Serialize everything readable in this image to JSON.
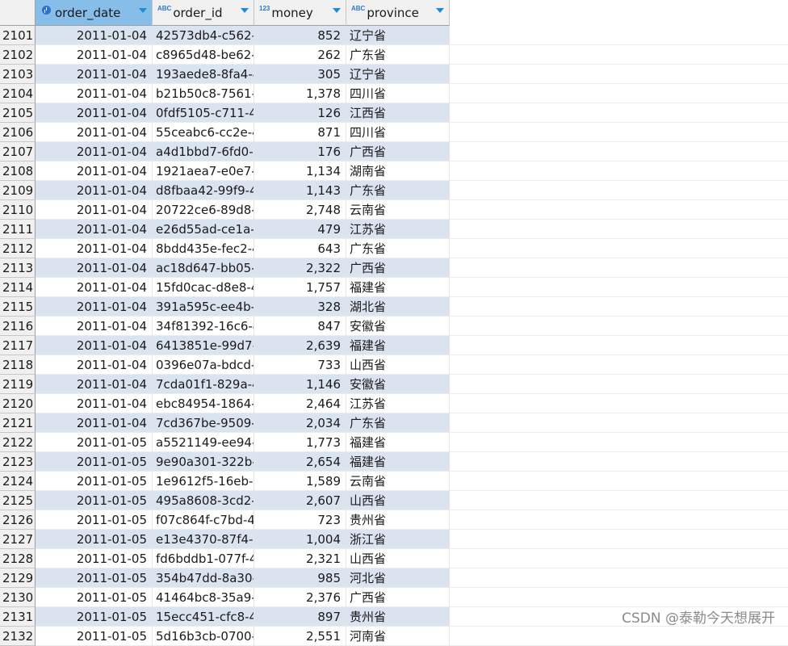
{
  "columns": [
    {
      "name": "order_date",
      "type_icon": "clock-icon",
      "type_label": ""
    },
    {
      "name": "order_id",
      "type_icon": "text-type-icon",
      "type_label": "ABC"
    },
    {
      "name": "money",
      "type_icon": "number-type-icon",
      "type_label": "123"
    },
    {
      "name": "province",
      "type_icon": "text-type-icon",
      "type_label": "ABC"
    }
  ],
  "rows": [
    {
      "n": "2101",
      "date": "2011-01-04",
      "id": "42573db4-c562-",
      "money": "852",
      "prov": "辽宁省"
    },
    {
      "n": "2102",
      "date": "2011-01-04",
      "id": "c8965d48-be62-",
      "money": "262",
      "prov": "广东省"
    },
    {
      "n": "2103",
      "date": "2011-01-04",
      "id": "193aede8-8fa4-4",
      "money": "305",
      "prov": "辽宁省"
    },
    {
      "n": "2104",
      "date": "2011-01-04",
      "id": "b21b50c8-7561-",
      "money": "1,378",
      "prov": "四川省"
    },
    {
      "n": "2105",
      "date": "2011-01-04",
      "id": "0fdf5105-c711-4",
      "money": "126",
      "prov": "江西省"
    },
    {
      "n": "2106",
      "date": "2011-01-04",
      "id": "55ceabc6-cc2e-4",
      "money": "871",
      "prov": "四川省"
    },
    {
      "n": "2107",
      "date": "2011-01-04",
      "id": "a4d1bbd7-6fd0-",
      "money": "176",
      "prov": "广西省"
    },
    {
      "n": "2108",
      "date": "2011-01-04",
      "id": "1921aea7-e0e7-4",
      "money": "1,134",
      "prov": "湖南省"
    },
    {
      "n": "2109",
      "date": "2011-01-04",
      "id": "d8fbaa42-99f9-4",
      "money": "1,143",
      "prov": "广东省"
    },
    {
      "n": "2110",
      "date": "2011-01-04",
      "id": "20722ce6-89d8-",
      "money": "2,748",
      "prov": "云南省"
    },
    {
      "n": "2111",
      "date": "2011-01-04",
      "id": "e26d55ad-ce1a-",
      "money": "479",
      "prov": "江苏省"
    },
    {
      "n": "2112",
      "date": "2011-01-04",
      "id": "8bdd435e-fec2-4",
      "money": "643",
      "prov": "广东省"
    },
    {
      "n": "2113",
      "date": "2011-01-04",
      "id": "ac18d647-bb05-",
      "money": "2,322",
      "prov": "广西省"
    },
    {
      "n": "2114",
      "date": "2011-01-04",
      "id": "15fd0cac-d8e8-4",
      "money": "1,757",
      "prov": "福建省"
    },
    {
      "n": "2115",
      "date": "2011-01-04",
      "id": "391a595c-ee4b-",
      "money": "328",
      "prov": "湖北省"
    },
    {
      "n": "2116",
      "date": "2011-01-04",
      "id": "34f81392-16c6-4",
      "money": "847",
      "prov": "安徽省"
    },
    {
      "n": "2117",
      "date": "2011-01-04",
      "id": "6413851e-99d7-",
      "money": "2,639",
      "prov": "福建省"
    },
    {
      "n": "2118",
      "date": "2011-01-04",
      "id": "0396e07a-bdcd-",
      "money": "733",
      "prov": "山西省"
    },
    {
      "n": "2119",
      "date": "2011-01-04",
      "id": "7cda01f1-829a-4",
      "money": "1,146",
      "prov": "安徽省"
    },
    {
      "n": "2120",
      "date": "2011-01-04",
      "id": "ebc84954-1864-",
      "money": "2,464",
      "prov": "江苏省"
    },
    {
      "n": "2121",
      "date": "2011-01-04",
      "id": "7cd367be-9509-",
      "money": "2,034",
      "prov": "广东省"
    },
    {
      "n": "2122",
      "date": "2011-01-05",
      "id": "a5521149-ee94-",
      "money": "1,773",
      "prov": "福建省"
    },
    {
      "n": "2123",
      "date": "2011-01-05",
      "id": "9e90a301-322b-",
      "money": "2,654",
      "prov": "福建省"
    },
    {
      "n": "2124",
      "date": "2011-01-05",
      "id": "1e9612f5-16eb-4",
      "money": "1,589",
      "prov": "云南省"
    },
    {
      "n": "2125",
      "date": "2011-01-05",
      "id": "495a8608-3cd2-",
      "money": "2,607",
      "prov": "山西省"
    },
    {
      "n": "2126",
      "date": "2011-01-05",
      "id": "f07c864f-c7bd-4",
      "money": "723",
      "prov": "贵州省"
    },
    {
      "n": "2127",
      "date": "2011-01-05",
      "id": "e13e4370-87f4-4",
      "money": "1,004",
      "prov": "浙江省"
    },
    {
      "n": "2128",
      "date": "2011-01-05",
      "id": "fd6bddb1-077f-4",
      "money": "2,321",
      "prov": "山西省"
    },
    {
      "n": "2129",
      "date": "2011-01-05",
      "id": "354b47dd-8a30-",
      "money": "985",
      "prov": "河北省"
    },
    {
      "n": "2130",
      "date": "2011-01-05",
      "id": "41464bc8-35a9-",
      "money": "2,376",
      "prov": "广西省"
    },
    {
      "n": "2131",
      "date": "2011-01-05",
      "id": "15ecc451-cfc8-4",
      "money": "897",
      "prov": "贵州省"
    },
    {
      "n": "2132",
      "date": "2011-01-05",
      "id": "5d16b3cb-0700-",
      "money": "2,551",
      "prov": "河南省"
    }
  ],
  "watermark": "CSDN @泰勒今天想展开"
}
